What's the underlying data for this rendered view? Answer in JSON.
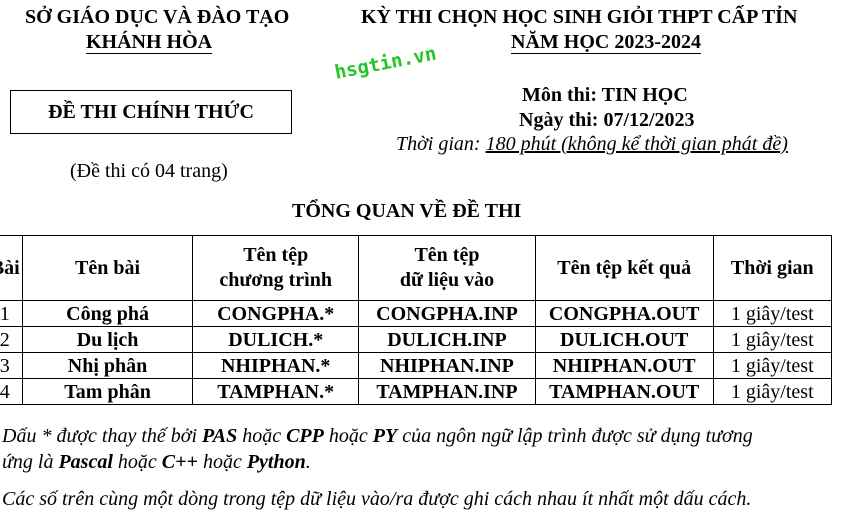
{
  "header": {
    "left_line1": "SỞ GIÁO DỤC VÀ ĐÀO TẠO",
    "left_line2": "KHÁNH HÒA",
    "right_line1": "KỲ THI CHỌN HỌC SINH GIỎI THPT CẤP TỈN",
    "right_line2": "NĂM HỌC 2023-2024"
  },
  "official_box": "ĐỀ THI CHÍNH THỨC",
  "watermark": "hsgtin.vn",
  "subject": "Môn thi: TIN HỌC",
  "exam_date": "Ngày thi: 07/12/2023",
  "duration": {
    "label": "Thời gian: ",
    "value": "180 phút (không kể thời gian phát đề)"
  },
  "page_count": "(Đề thi có 04 trang)",
  "section_title": "TỔNG QUAN VỀ ĐỀ THI",
  "table": {
    "headers": {
      "num": "Bài",
      "name": "Tên bài",
      "program_line1": "Tên tệp",
      "program_line2": "chương trình",
      "input_line1": "Tên tệp",
      "input_line2": "dữ liệu vào",
      "output": "Tên tệp kết quả",
      "time": "Thời gian"
    },
    "rows": [
      {
        "num": "1",
        "name": "Công phá",
        "program": "CONGPHA.*",
        "input": "CONGPHA.INP",
        "output": "CONGPHA.OUT",
        "time": "1 giây/test"
      },
      {
        "num": "2",
        "name": "Du lịch",
        "program": "DULICH.*",
        "input": "DULICH.INP",
        "output": "DULICH.OUT",
        "time": "1 giây/test"
      },
      {
        "num": "3",
        "name": "Nhị phân",
        "program": "NHIPHAN.*",
        "input": "NHIPHAN.INP",
        "output": "NHIPHAN.OUT",
        "time": "1 giây/test"
      },
      {
        "num": "4",
        "name": "Tam phân",
        "program": "TAMPHAN.*",
        "input": "TAMPHAN.INP",
        "output": "TAMPHAN.OUT",
        "time": "1 giây/test"
      }
    ]
  },
  "note1": {
    "p1": "Dấu * được thay thế bởi ",
    "b1": "PAS",
    "p2": " hoặc ",
    "b2": "CPP",
    "p3": " hoặc ",
    "b3": "PY",
    "p4": " của ngôn ngữ lập trình được sử dụng tương",
    "p5": "ứng là ",
    "b4": "Pascal",
    "p6": " hoặc ",
    "b5": "C++",
    "p7": " hoặc ",
    "b6": "Python",
    "p8": "."
  },
  "note2": "Các số trên cùng một dòng trong tệp dữ liệu vào/ra được ghi cách nhau ít nhất một dấu cách."
}
